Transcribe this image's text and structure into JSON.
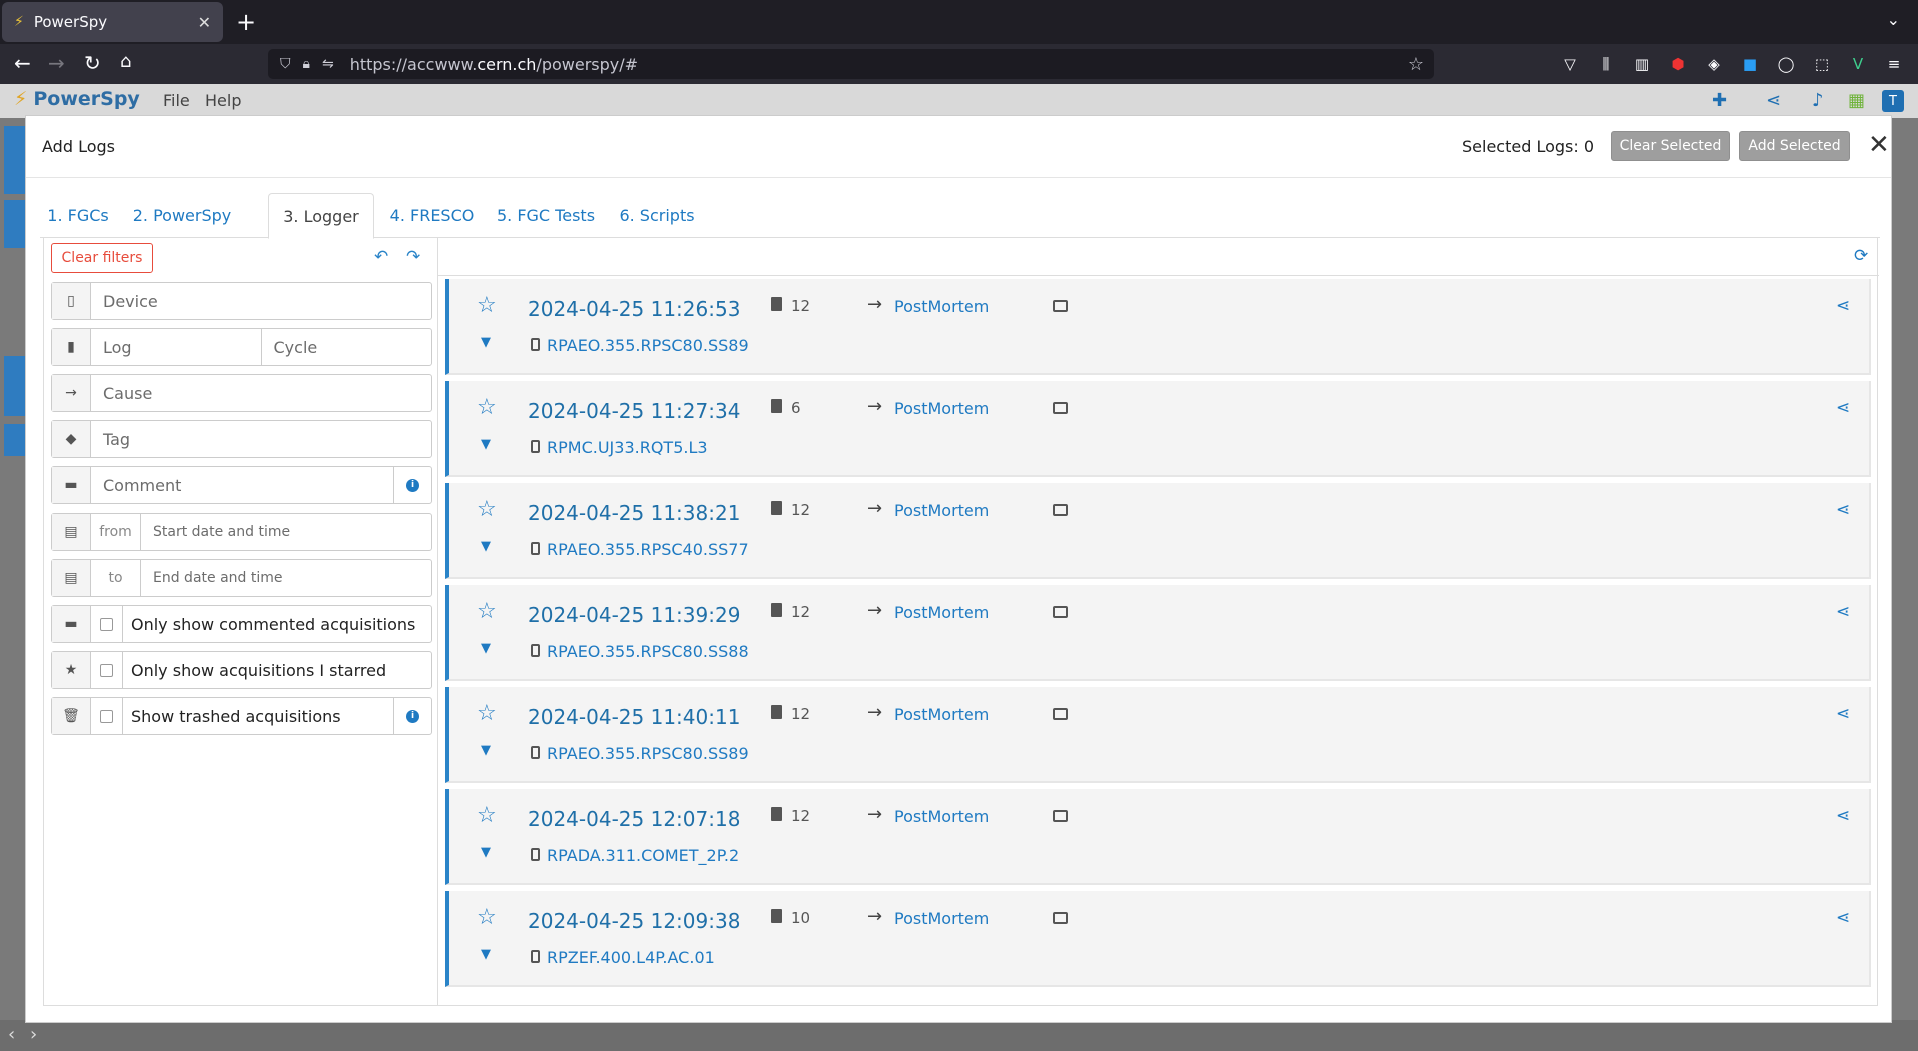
{
  "browser": {
    "tab_title": "PowerSpy",
    "url_prefix": "https://accwww.",
    "url_host": "cern.ch",
    "url_path": "/powerspy/#"
  },
  "app": {
    "name": "PowerSpy",
    "menu": [
      "File",
      "Help"
    ],
    "avatar_letter": "T"
  },
  "modal": {
    "title": "Add Logs",
    "selected_label": "Selected Logs: 0",
    "clear_selected": "Clear Selected",
    "add_selected": "Add Selected",
    "tabs": [
      "1. FGCs",
      "2. PowerSpy",
      "3. Logger",
      "4. FRESCO",
      "5. FGC Tests",
      "6. Scripts"
    ],
    "active_tab": 2
  },
  "filters": {
    "clear_label": "Clear filters",
    "device_placeholder": "Device",
    "log_placeholder": "Log",
    "cycle_placeholder": "Cycle",
    "cause_placeholder": "Cause",
    "tag_placeholder": "Tag",
    "comment_placeholder": "Comment",
    "from_label": "from",
    "from_placeholder": "Start date and time",
    "to_label": "to",
    "to_placeholder": "End date and time",
    "only_commented": "Only show commented acquisitions",
    "only_starred": "Only show acquisitions I starred",
    "show_trashed": "Show trashed acquisitions"
  },
  "logs": [
    {
      "timestamp": "2024-04-25 11:26:53",
      "count": "12",
      "cause": "PostMortem",
      "device": "RPAEO.355.RPSC80.SS89"
    },
    {
      "timestamp": "2024-04-25 11:27:34",
      "count": "6",
      "cause": "PostMortem",
      "device": "RPMC.UJ33.RQT5.L3"
    },
    {
      "timestamp": "2024-04-25 11:38:21",
      "count": "12",
      "cause": "PostMortem",
      "device": "RPAEO.355.RPSC40.SS77"
    },
    {
      "timestamp": "2024-04-25 11:39:29",
      "count": "12",
      "cause": "PostMortem",
      "device": "RPAEO.355.RPSC80.SS88"
    },
    {
      "timestamp": "2024-04-25 11:40:11",
      "count": "12",
      "cause": "PostMortem",
      "device": "RPAEO.355.RPSC80.SS89"
    },
    {
      "timestamp": "2024-04-25 12:07:18",
      "count": "12",
      "cause": "PostMortem",
      "device": "RPADA.311.COMET_2P.2"
    },
    {
      "timestamp": "2024-04-25 12:09:38",
      "count": "10",
      "cause": "PostMortem",
      "device": "RPZEF.400.L4P.AC.01"
    }
  ],
  "colors": {
    "accent": "#1f7ac2",
    "danger": "#e74c3c",
    "card_bg": "#f4f4f4"
  }
}
